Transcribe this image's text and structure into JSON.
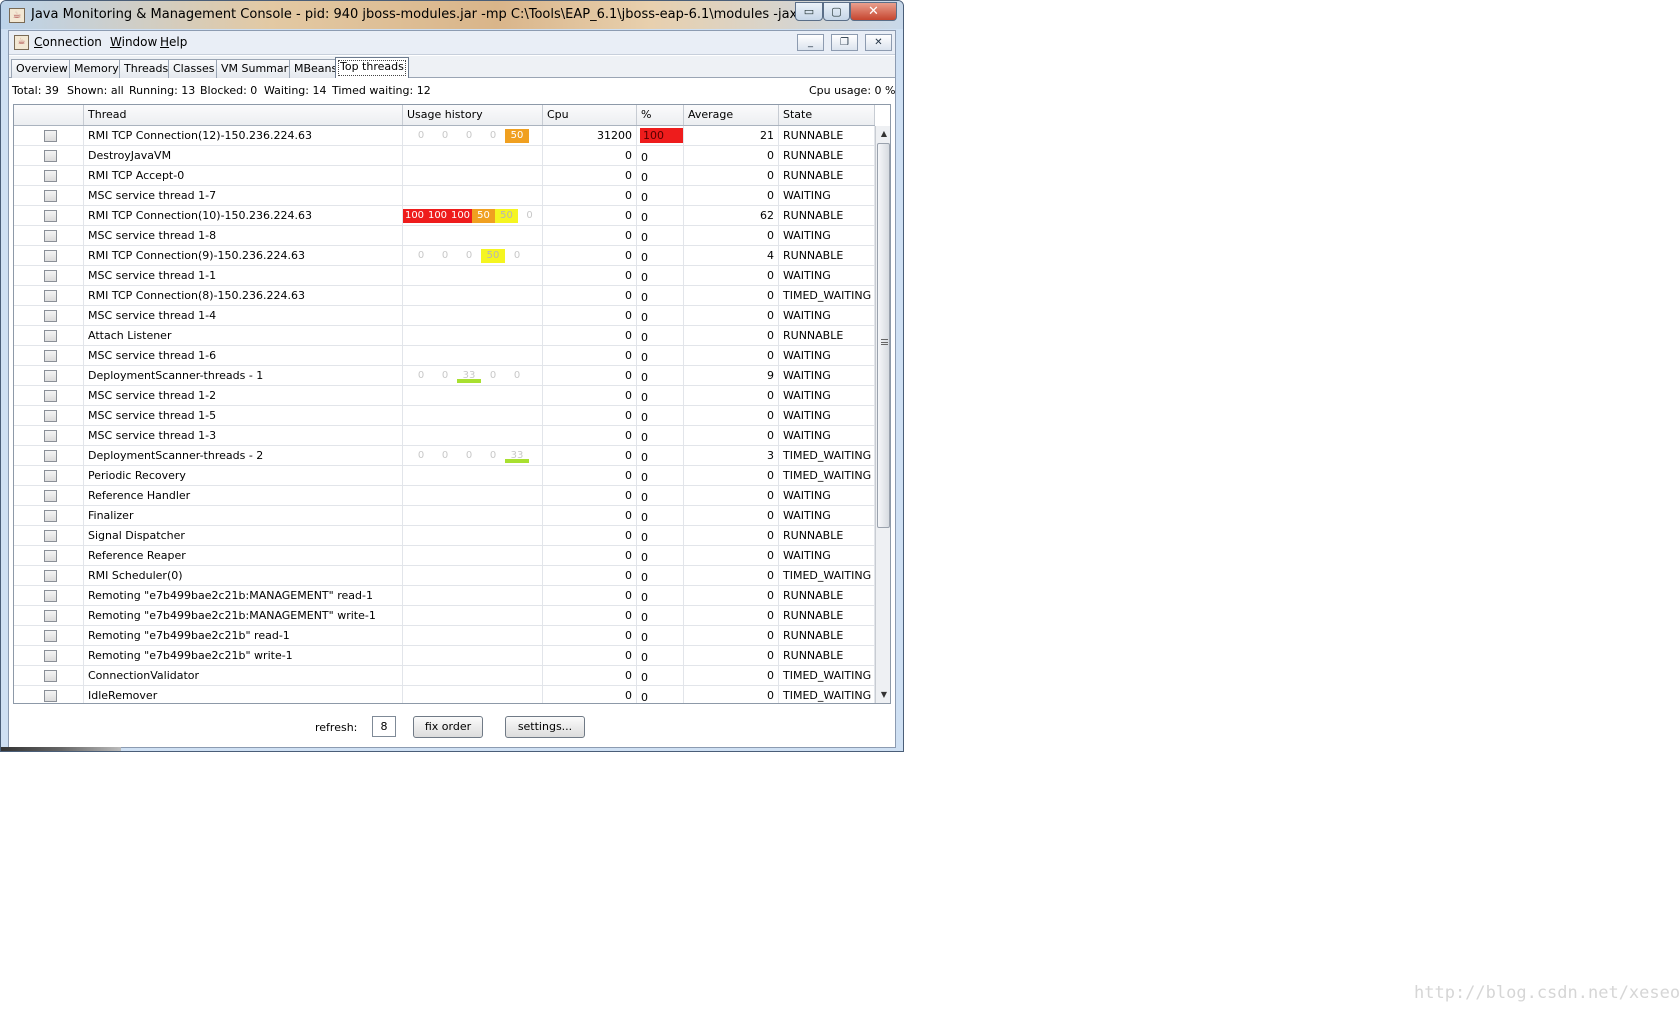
{
  "window": {
    "title": "Java Monitoring & Management Console - pid: 940 jboss-modules.jar -mp C:\\Tools\\EAP_6.1\\jboss-eap-6.1\\modules -jaxpmodule javax.xml.ja...",
    "minimize_glyph": "▭",
    "maximize_glyph": "▢",
    "close_glyph": "✕"
  },
  "menu": {
    "icon_glyph": "☕",
    "connection_key": "C",
    "connection_rest": "onnection",
    "window_key": "W",
    "window_rest": "indow",
    "help_key": "H",
    "help_rest": "elp",
    "inner_min_glyph": "_",
    "inner_restore_glyph": "❐",
    "inner_close_glyph": "✕"
  },
  "tabs": [
    "Overview",
    "Memory",
    "Threads",
    "Classes",
    "VM Summary",
    "MBeans",
    "Top threads"
  ],
  "active_tab": "Top threads",
  "stats": {
    "total": "Total: 39",
    "shown": "Shown: all",
    "running": "Running: 13",
    "blocked": "Blocked: 0",
    "waiting": "Waiting: 14",
    "timed_waiting": "Timed waiting: 12",
    "cpu_usage": "Cpu usage:  0 %"
  },
  "table": {
    "headers": [
      "",
      "Thread",
      "Usage history",
      "Cpu",
      "%",
      "Average",
      "State"
    ],
    "rows": [
      {
        "thread": "RMI TCP Connection(12)-150.236.224.63",
        "history": [
          "0",
          "0",
          "0",
          "0",
          "50"
        ],
        "history_colors": [
          "",
          "",
          "",
          "",
          "#f0a020"
        ],
        "cpu": "31200",
        "pct": "100",
        "pct_bar": true,
        "avg": "21",
        "state": "RUNNABLE"
      },
      {
        "thread": "DestroyJavaVM",
        "history": [],
        "history_colors": [],
        "cpu": "0",
        "pct": "0",
        "pct_bar": false,
        "avg": "0",
        "state": "RUNNABLE"
      },
      {
        "thread": "RMI TCP Accept-0",
        "history": [],
        "history_colors": [],
        "cpu": "0",
        "pct": "0",
        "pct_bar": false,
        "avg": "0",
        "state": "RUNNABLE"
      },
      {
        "thread": "MSC service thread 1-7",
        "history": [],
        "history_colors": [],
        "cpu": "0",
        "pct": "0",
        "pct_bar": false,
        "avg": "0",
        "state": "WAITING"
      },
      {
        "thread": "RMI TCP Connection(10)-150.236.224.63",
        "history": [
          "100",
          "100",
          "100",
          "50",
          "50",
          "0"
        ],
        "history_colors": [
          "#ee1c1c",
          "#ee1c1c",
          "#ee1c1c",
          "#f0a020",
          "#f5f520",
          ""
        ],
        "cpu": "0",
        "pct": "0",
        "pct_bar": false,
        "avg": "62",
        "state": "RUNNABLE"
      },
      {
        "thread": "MSC service thread 1-8",
        "history": [],
        "history_colors": [],
        "cpu": "0",
        "pct": "0",
        "pct_bar": false,
        "avg": "0",
        "state": "WAITING"
      },
      {
        "thread": "RMI TCP Connection(9)-150.236.224.63",
        "history": [
          "0",
          "0",
          "0",
          "50",
          "0"
        ],
        "history_colors": [
          "",
          "",
          "",
          "#f5f520",
          ""
        ],
        "cpu": "0",
        "pct": "0",
        "pct_bar": false,
        "avg": "4",
        "state": "RUNNABLE"
      },
      {
        "thread": "MSC service thread 1-1",
        "history": [],
        "history_colors": [],
        "cpu": "0",
        "pct": "0",
        "pct_bar": false,
        "avg": "0",
        "state": "WAITING"
      },
      {
        "thread": "RMI TCP Connection(8)-150.236.224.63",
        "history": [],
        "history_colors": [],
        "cpu": "0",
        "pct": "0",
        "pct_bar": false,
        "avg": "0",
        "state": "TIMED_WAITING"
      },
      {
        "thread": "MSC service thread 1-4",
        "history": [],
        "history_colors": [],
        "cpu": "0",
        "pct": "0",
        "pct_bar": false,
        "avg": "0",
        "state": "WAITING"
      },
      {
        "thread": "Attach Listener",
        "history": [],
        "history_colors": [],
        "cpu": "0",
        "pct": "0",
        "pct_bar": false,
        "avg": "0",
        "state": "RUNNABLE"
      },
      {
        "thread": "MSC service thread 1-6",
        "history": [],
        "history_colors": [],
        "cpu": "0",
        "pct": "0",
        "pct_bar": false,
        "avg": "0",
        "state": "WAITING"
      },
      {
        "thread": "DeploymentScanner-threads - 1",
        "history": [
          "0",
          "0",
          "33",
          "0",
          "0"
        ],
        "history_colors": [
          "",
          "",
          "#a8e030",
          "",
          ""
        ],
        "cpu": "0",
        "pct": "0",
        "pct_bar": false,
        "avg": "9",
        "state": "WAITING"
      },
      {
        "thread": "MSC service thread 1-2",
        "history": [],
        "history_colors": [],
        "cpu": "0",
        "pct": "0",
        "pct_bar": false,
        "avg": "0",
        "state": "WAITING"
      },
      {
        "thread": "MSC service thread 1-5",
        "history": [],
        "history_colors": [],
        "cpu": "0",
        "pct": "0",
        "pct_bar": false,
        "avg": "0",
        "state": "WAITING"
      },
      {
        "thread": "MSC service thread 1-3",
        "history": [],
        "history_colors": [],
        "cpu": "0",
        "pct": "0",
        "pct_bar": false,
        "avg": "0",
        "state": "WAITING"
      },
      {
        "thread": "DeploymentScanner-threads - 2",
        "history": [
          "0",
          "0",
          "0",
          "0",
          "33"
        ],
        "history_colors": [
          "",
          "",
          "",
          "",
          "#a8e030"
        ],
        "cpu": "0",
        "pct": "0",
        "pct_bar": false,
        "avg": "3",
        "state": "TIMED_WAITING"
      },
      {
        "thread": "Periodic Recovery",
        "history": [],
        "history_colors": [],
        "cpu": "0",
        "pct": "0",
        "pct_bar": false,
        "avg": "0",
        "state": "TIMED_WAITING"
      },
      {
        "thread": "Reference Handler",
        "history": [],
        "history_colors": [],
        "cpu": "0",
        "pct": "0",
        "pct_bar": false,
        "avg": "0",
        "state": "WAITING"
      },
      {
        "thread": "Finalizer",
        "history": [],
        "history_colors": [],
        "cpu": "0",
        "pct": "0",
        "pct_bar": false,
        "avg": "0",
        "state": "WAITING"
      },
      {
        "thread": "Signal Dispatcher",
        "history": [],
        "history_colors": [],
        "cpu": "0",
        "pct": "0",
        "pct_bar": false,
        "avg": "0",
        "state": "RUNNABLE"
      },
      {
        "thread": "Reference Reaper",
        "history": [],
        "history_colors": [],
        "cpu": "0",
        "pct": "0",
        "pct_bar": false,
        "avg": "0",
        "state": "WAITING"
      },
      {
        "thread": "RMI Scheduler(0)",
        "history": [],
        "history_colors": [],
        "cpu": "0",
        "pct": "0",
        "pct_bar": false,
        "avg": "0",
        "state": "TIMED_WAITING"
      },
      {
        "thread": "Remoting \"e7b499bae2c21b:MANAGEMENT\" read-1",
        "history": [],
        "history_colors": [],
        "cpu": "0",
        "pct": "0",
        "pct_bar": false,
        "avg": "0",
        "state": "RUNNABLE"
      },
      {
        "thread": "Remoting \"e7b499bae2c21b:MANAGEMENT\" write-1",
        "history": [],
        "history_colors": [],
        "cpu": "0",
        "pct": "0",
        "pct_bar": false,
        "avg": "0",
        "state": "RUNNABLE"
      },
      {
        "thread": "Remoting \"e7b499bae2c21b\" read-1",
        "history": [],
        "history_colors": [],
        "cpu": "0",
        "pct": "0",
        "pct_bar": false,
        "avg": "0",
        "state": "RUNNABLE"
      },
      {
        "thread": "Remoting \"e7b499bae2c21b\" write-1",
        "history": [],
        "history_colors": [],
        "cpu": "0",
        "pct": "0",
        "pct_bar": false,
        "avg": "0",
        "state": "RUNNABLE"
      },
      {
        "thread": "ConnectionValidator",
        "history": [],
        "history_colors": [],
        "cpu": "0",
        "pct": "0",
        "pct_bar": false,
        "avg": "0",
        "state": "TIMED_WAITING"
      },
      {
        "thread": "IdleRemover",
        "history": [],
        "history_colors": [],
        "cpu": "0",
        "pct": "0",
        "pct_bar": false,
        "avg": "0",
        "state": "TIMED_WAITING"
      }
    ]
  },
  "scrollbar": {
    "up_glyph": "▲",
    "down_glyph": "▼"
  },
  "bottom": {
    "refresh_label": "refresh:",
    "refresh_value": "8",
    "fix_order_label": "fix order",
    "settings_label": "settings..."
  },
  "watermark": "http://blog.csdn.net/xeseo"
}
